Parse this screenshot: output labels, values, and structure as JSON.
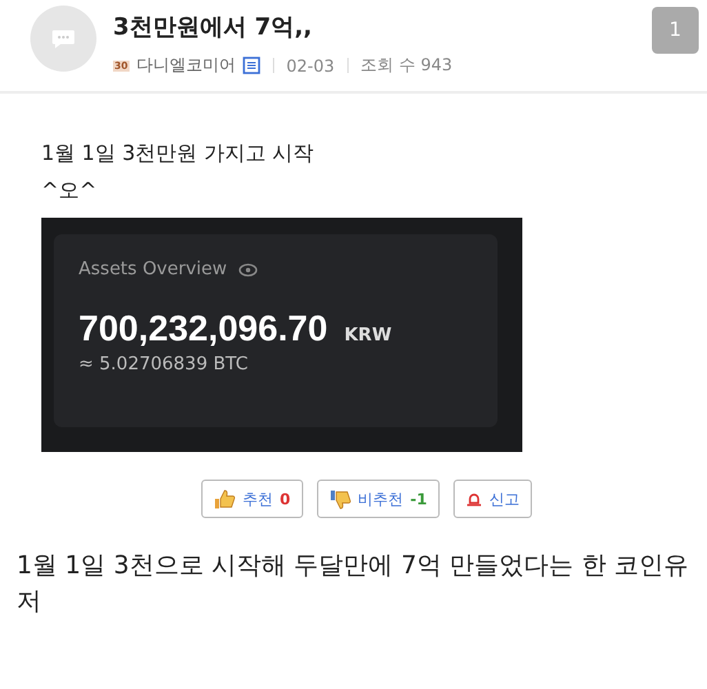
{
  "post": {
    "title": "3천만원에서 7억,,",
    "level_badge": "30",
    "author": "다니엘코미어",
    "date": "02-03",
    "views": "조회 수 943",
    "comment_count": "1"
  },
  "body": {
    "lines": [
      "1월 1일 3천만원 가지고 시작",
      "^오^"
    ],
    "screenshot": {
      "heading": "Assets Overview",
      "amount": "700,232,096.70",
      "currency": "KRW",
      "btc": "≈ 5.02706839 BTC"
    }
  },
  "votes": [
    {
      "kind": "up",
      "label": "추천",
      "count": "0"
    },
    {
      "kind": "down",
      "label": "비추천",
      "count": "-1"
    },
    {
      "kind": "report",
      "label": "신고"
    }
  ],
  "caption": "1월 1일 3천으로 시작해 두달만에 7억 만들었다는 한 코인유저"
}
